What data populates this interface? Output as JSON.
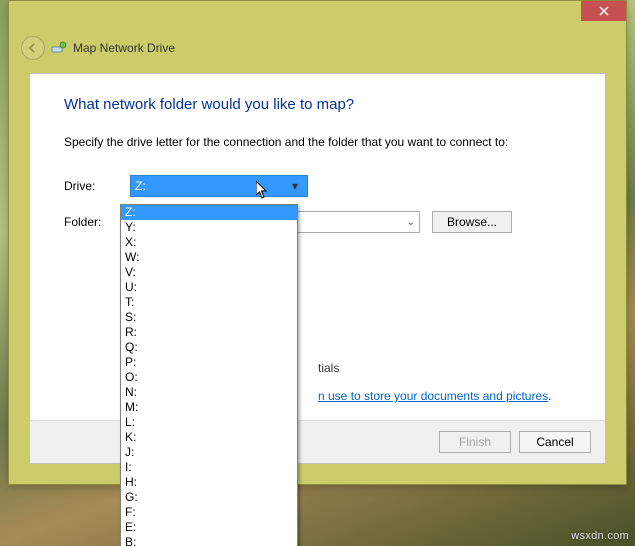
{
  "window": {
    "title": "Map Network Drive"
  },
  "content": {
    "heading": "What network folder would you like to map?",
    "instruction": "Specify the drive letter for the connection and the folder that you want to connect to:",
    "drive_label": "Drive:",
    "folder_label": "Folder:",
    "drive_selected": "Z:",
    "folder_value": "",
    "browse_label": "Browse...",
    "credentials_partial": "tials",
    "link_partial": "n use to store your documents and pictures",
    "link_suffix": "."
  },
  "drive_options": [
    "Z:",
    "Y:",
    "X:",
    "W:",
    "V:",
    "U:",
    "T:",
    "S:",
    "R:",
    "Q:",
    "P:",
    "O:",
    "N:",
    "M:",
    "L:",
    "K:",
    "J:",
    "I:",
    "H:",
    "G:",
    "F:",
    "E:",
    "B:"
  ],
  "buttons": {
    "finish": "Finish",
    "cancel": "Cancel"
  },
  "watermark": "wsxdn.com"
}
